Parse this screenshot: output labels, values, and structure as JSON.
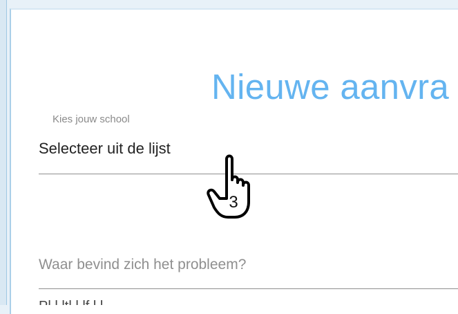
{
  "form": {
    "title": "Nieuwe aanvra",
    "school_field": {
      "caption": "Kies jouw school",
      "selected_value": "Selecteer uit de lijst"
    },
    "location_field": {
      "value": "",
      "placeholder": "Waar bevind zich het probleem?"
    },
    "next_field_partial": "Pl   l   ltl   l     lf     l             l       "
  },
  "annotation": {
    "step_number": "3",
    "cursor_icon": "hand-pointer-icon"
  },
  "colors": {
    "title": "#64b4f0",
    "field_line": "#8d8d8d",
    "card_border": "#aacfe8",
    "background": "#e8f1f8"
  }
}
